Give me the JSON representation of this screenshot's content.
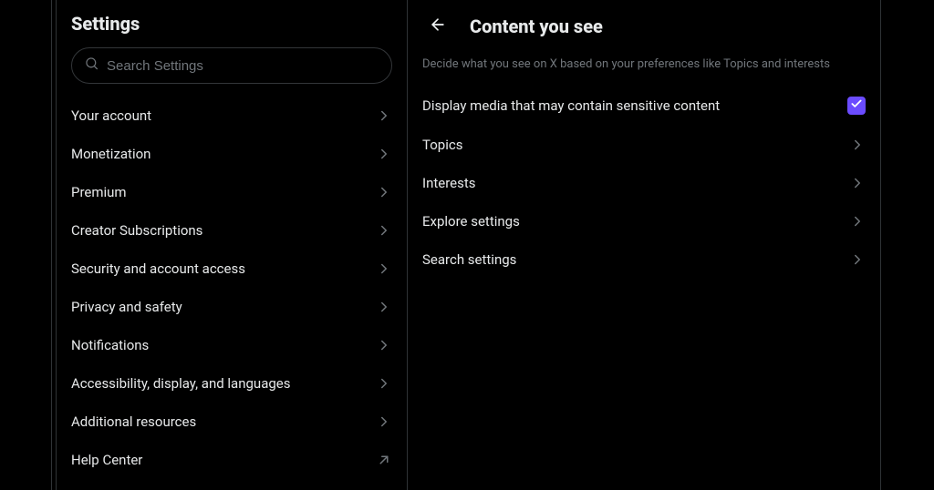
{
  "settings": {
    "title": "Settings",
    "searchPlaceholder": "Search Settings",
    "nav": [
      {
        "label": "Your account",
        "kind": "chevron"
      },
      {
        "label": "Monetization",
        "kind": "chevron"
      },
      {
        "label": "Premium",
        "kind": "chevron"
      },
      {
        "label": "Creator Subscriptions",
        "kind": "chevron"
      },
      {
        "label": "Security and account access",
        "kind": "chevron"
      },
      {
        "label": "Privacy and safety",
        "kind": "chevron"
      },
      {
        "label": "Notifications",
        "kind": "chevron"
      },
      {
        "label": "Accessibility, display, and languages",
        "kind": "chevron"
      },
      {
        "label": "Additional resources",
        "kind": "chevron"
      },
      {
        "label": "Help Center",
        "kind": "external"
      }
    ]
  },
  "content": {
    "title": "Content you see",
    "description": "Decide what you see on X based on your preferences like Topics and interests",
    "toggleRow": {
      "label": "Display media that may contain sensitive content",
      "checked": true
    },
    "rows": [
      {
        "label": "Topics"
      },
      {
        "label": "Interests"
      },
      {
        "label": "Explore settings"
      },
      {
        "label": "Search settings"
      }
    ]
  },
  "colors": {
    "accent": "#6b4cff"
  }
}
